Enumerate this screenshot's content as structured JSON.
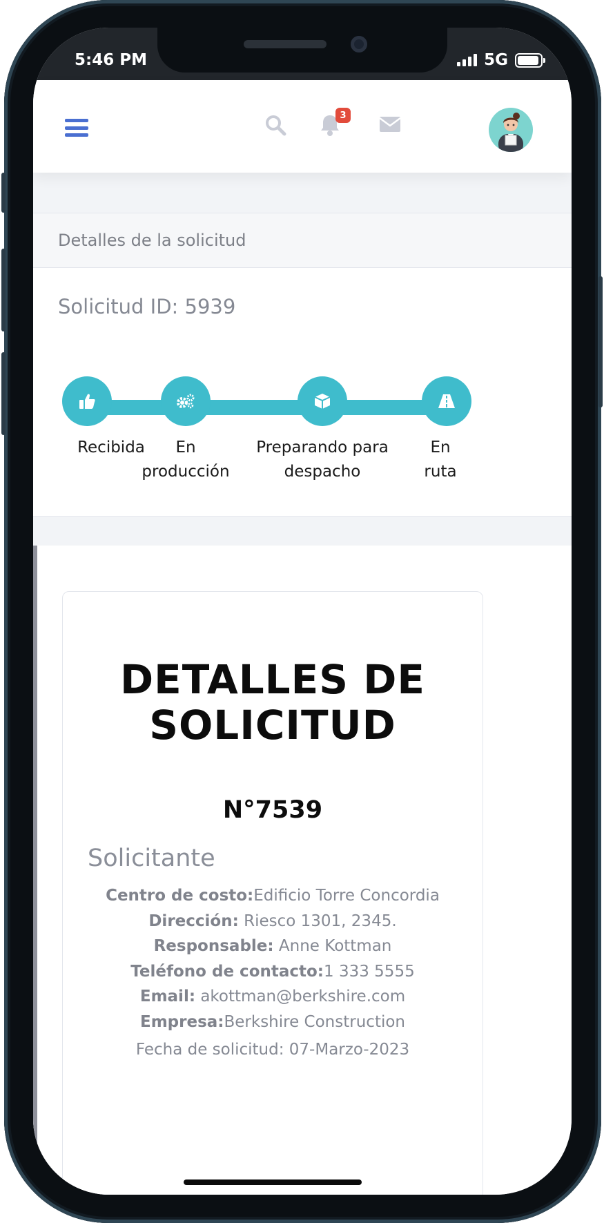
{
  "status_bar": {
    "time": "5:46 PM",
    "network": "5G"
  },
  "topbar": {
    "notification_count": "3"
  },
  "request_card": {
    "header": "Detalles de la solicitud",
    "request_id": "Solicitud ID: 5939",
    "steps": [
      {
        "icon": "thumbs-up-icon",
        "label": "Recibida"
      },
      {
        "icon": "gears-icon",
        "label": "En producción"
      },
      {
        "icon": "box-icon",
        "label": "Preparando para despacho"
      },
      {
        "icon": "road-icon",
        "label": "En ruta"
      }
    ]
  },
  "details": {
    "title": "DETALLES DE SOLICITUD",
    "number": "N°7539",
    "section": "Solicitante",
    "fields": [
      {
        "label": "Centro de costo:",
        "value": "Edificio Torre Concordia"
      },
      {
        "label": "Dirección:",
        "value": " Riesco 1301, 2345."
      },
      {
        "label": "Responsable:",
        "value": " Anne Kottman"
      },
      {
        "label": "Teléfono de contacto:",
        "value": "1 333 5555"
      },
      {
        "label": "Email:",
        "value": " akottman@berkshire.com"
      },
      {
        "label": "Empresa:",
        "value": "Berkshire Construction"
      }
    ],
    "date": "Fecha de solicitud: 07-Marzo-2023"
  },
  "colors": {
    "accent": "#3fbccc",
    "menu": "#4a6fd1",
    "badge": "#e24b3b"
  }
}
